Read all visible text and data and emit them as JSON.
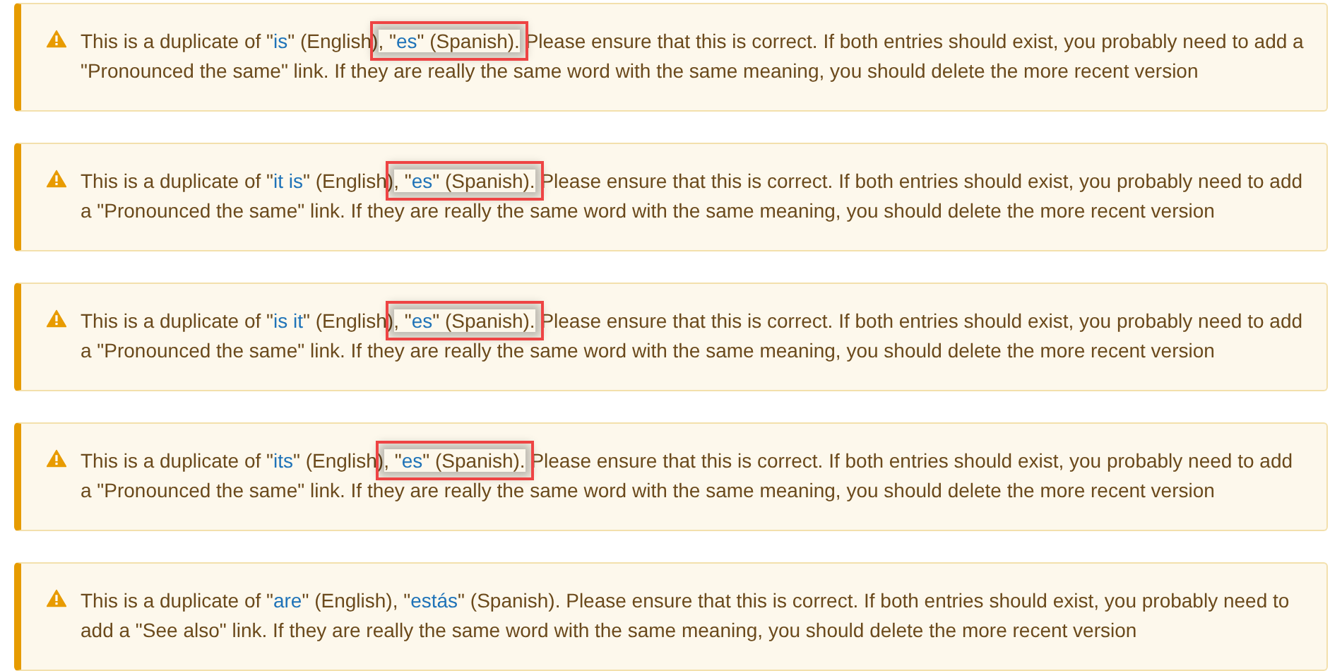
{
  "alerts": [
    {
      "before": "This is a duplicate of \"",
      "english": "is",
      "between": "\" (English)",
      "highlighted": true,
      "spanish_before": ", \"",
      "spanish": "es",
      "spanish_after": "\" (Spanish).",
      "after": " Please ensure that this is correct. If both entries should exist, you probably need to add a \"Pronounced the same\" link. If they are really the same word with the same meaning, you should delete the more recent version"
    },
    {
      "before": "This is a duplicate of \"",
      "english": "it is",
      "between": "\" (English)",
      "highlighted": true,
      "spanish_before": ", \"",
      "spanish": "es",
      "spanish_after": "\" (Spanish).",
      "after": " Please ensure that this is correct. If both entries should exist, you probably need to add a \"Pronounced the same\" link. If they are really the same word with the same meaning, you should delete the more recent version"
    },
    {
      "before": "This is a duplicate of \"",
      "english": "is it",
      "between": "\" (English)",
      "highlighted": true,
      "spanish_before": ", \"",
      "spanish": "es",
      "spanish_after": "\" (Spanish).",
      "after": " Please ensure that this is correct. If both entries should exist, you probably need to add a \"Pronounced the same\" link. If they are really the same word with the same meaning, you should delete the more recent version"
    },
    {
      "before": "This is a duplicate of \"",
      "english": "its",
      "between": "\" (English)",
      "highlighted": true,
      "spanish_before": ", \"",
      "spanish": "es",
      "spanish_after": "\" (Spanish).",
      "after": " Please ensure that this is correct. If both entries should exist, you probably need to add a \"Pronounced the same\" link. If they are really the same word with the same meaning, you should delete the more recent version"
    },
    {
      "before": "This is a duplicate of \"",
      "english": "are",
      "between": "\" (English)",
      "highlighted": false,
      "spanish_before": ", \"",
      "spanish": "estás",
      "spanish_after": "\" (Spanish).",
      "after": " Please ensure that this is correct. If both entries should exist, you probably need to add a \"See also\" link. If they are really the same word with the same meaning, you should delete the more recent version"
    }
  ]
}
